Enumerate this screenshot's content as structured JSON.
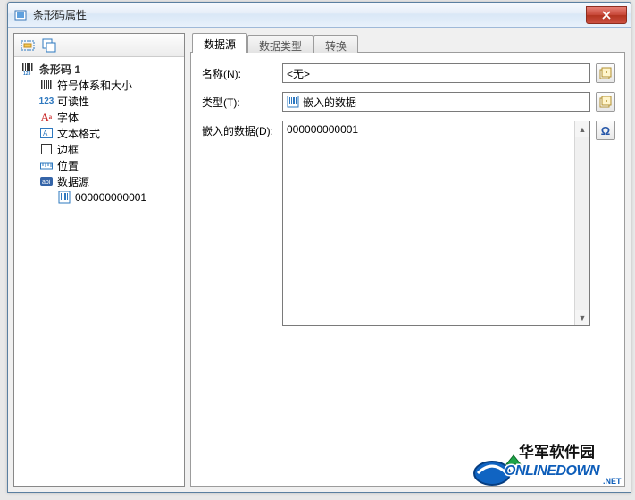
{
  "window": {
    "title": "条形码属性"
  },
  "tree": {
    "root": "条形码 1",
    "items": [
      {
        "label": "符号体系和大小",
        "icon": "barcode"
      },
      {
        "label": "可读性",
        "icon": "num123"
      },
      {
        "label": "字体",
        "icon": "font-a"
      },
      {
        "label": "文本格式",
        "icon": "textbox"
      },
      {
        "label": "边框",
        "icon": "border-square"
      },
      {
        "label": "位置",
        "icon": "ruler"
      },
      {
        "label": "数据源",
        "icon": "data-abc"
      }
    ],
    "data_source_child": "000000000001"
  },
  "tabs": [
    "数据源",
    "数据类型",
    "转换"
  ],
  "form": {
    "name_label": "名称(N):",
    "name_value": "<无>",
    "type_label": "类型(T):",
    "type_value": "嵌入的数据",
    "data_label": "嵌入的数据(D):",
    "data_value": "000000000001"
  },
  "watermark": {
    "line1": "华军软件园",
    "line2": "ONLINEDOWN",
    "suffix": ".NET"
  }
}
